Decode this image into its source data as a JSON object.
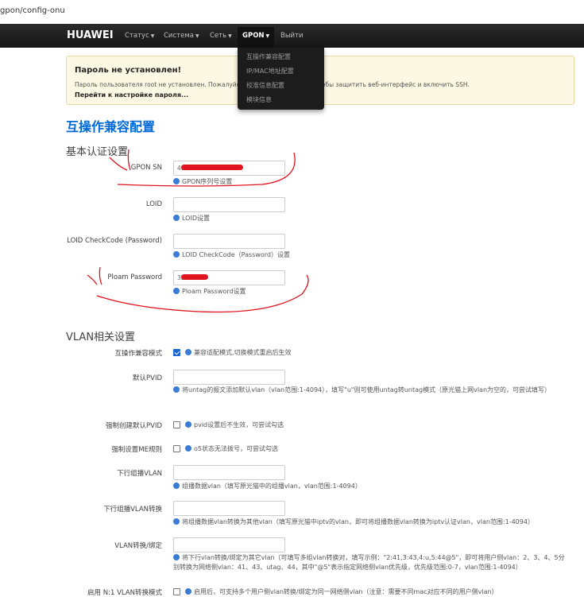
{
  "browser": {
    "url": "gpon/config-onu"
  },
  "navbar": {
    "brand": "HUAWEI",
    "items": [
      {
        "label": "Статус"
      },
      {
        "label": "Система"
      },
      {
        "label": "Сеть"
      },
      {
        "label": "GPON"
      },
      {
        "label": "Выйти"
      }
    ],
    "dropdown": [
      "互操作兼容配置",
      "IP/MAC地址配置",
      "校准信息配置",
      "模块信息"
    ]
  },
  "alert": {
    "title": "Пароль не установлен!",
    "text": "Пароль пользователя root не установлен. Пожалуйста, установите пароль, чтобы защитить веб-интерфейс и включить SSH.",
    "link": "Перейти к настройке пароля..."
  },
  "page": {
    "title": "互操作兼容配置"
  },
  "auth": {
    "section_title": "基本认证设置",
    "fields": [
      {
        "label": "GPON SN",
        "value": "49",
        "help": "GPON序列号设置"
      },
      {
        "label": "LOID",
        "value": "",
        "help": "LOID设置"
      },
      {
        "label": "LOID CheckCode (Password)",
        "value": "",
        "help": "LOID CheckCode（Password）设置"
      },
      {
        "label": "Ploam Password",
        "value": "32",
        "help": "Ploam Password设置"
      }
    ]
  },
  "vlan": {
    "section_title": "VLAN相关设置",
    "compat_mode": {
      "label": "互操作兼容模式",
      "checked": true,
      "help": "兼容适配模式,切换模式重启后生效"
    },
    "default_pvid": {
      "label": "默认PVID",
      "value": "",
      "help": "将untag的报文添加默认vlan（vlan范围:1-4094），填写\"u\"则可使用untag转untag模式（原光猫上网vlan为空的，可尝试填写）"
    },
    "force_pvid": {
      "label": "强制创建默认PVID",
      "checked": false,
      "help": "pvid设置后不生效，可尝试勾选"
    },
    "force_me": {
      "label": "强制设置ME规则",
      "checked": false,
      "help": "o5状态无法拨号，可尝试勾选"
    },
    "mcast_vlan": {
      "label": "下行组播VLAN",
      "value": "",
      "help": "组播数据vlan（填写原光猫中的组播vlan，vlan范围:1-4094）"
    },
    "mcast_translate": {
      "label": "下行组播VLAN转换",
      "value": "",
      "help": "将组播数据vlan转换为其他vlan（填写原光猫中iptv的vlan，即可将组播数据vlan转换为iptv认证vlan，vlan范围:1-4094）"
    },
    "vlan_bind": {
      "label": "VLAN转换/绑定",
      "value": "",
      "help": "将下行vlan转换/绑定为其它vlan（可填写多组vlan转换对，填写示例：\"2:41,3:43,4:u,5:44@5\"，即可将用户侧vlan：2、3、4、5分别转换为网络侧vlan：41、43、utag、44，其中\"@5\"表示指定网络侧vlan优先级，优先级范围:0-7，vlan范围:1-4094）"
    },
    "n1_vlan": {
      "label": "启用 N:1 VLAN转换模式",
      "checked": false,
      "help": "启用后，可支持多个用户侧vlan转换/绑定为同一网络侧vlan（注意：需要不同mac对应不同的用户侧vlan）"
    }
  },
  "colors": {
    "accent": "#0069d6",
    "navbar": "#1e1e1e",
    "alert_bg": "#fcf8e3",
    "annotation": "#e0141e"
  }
}
